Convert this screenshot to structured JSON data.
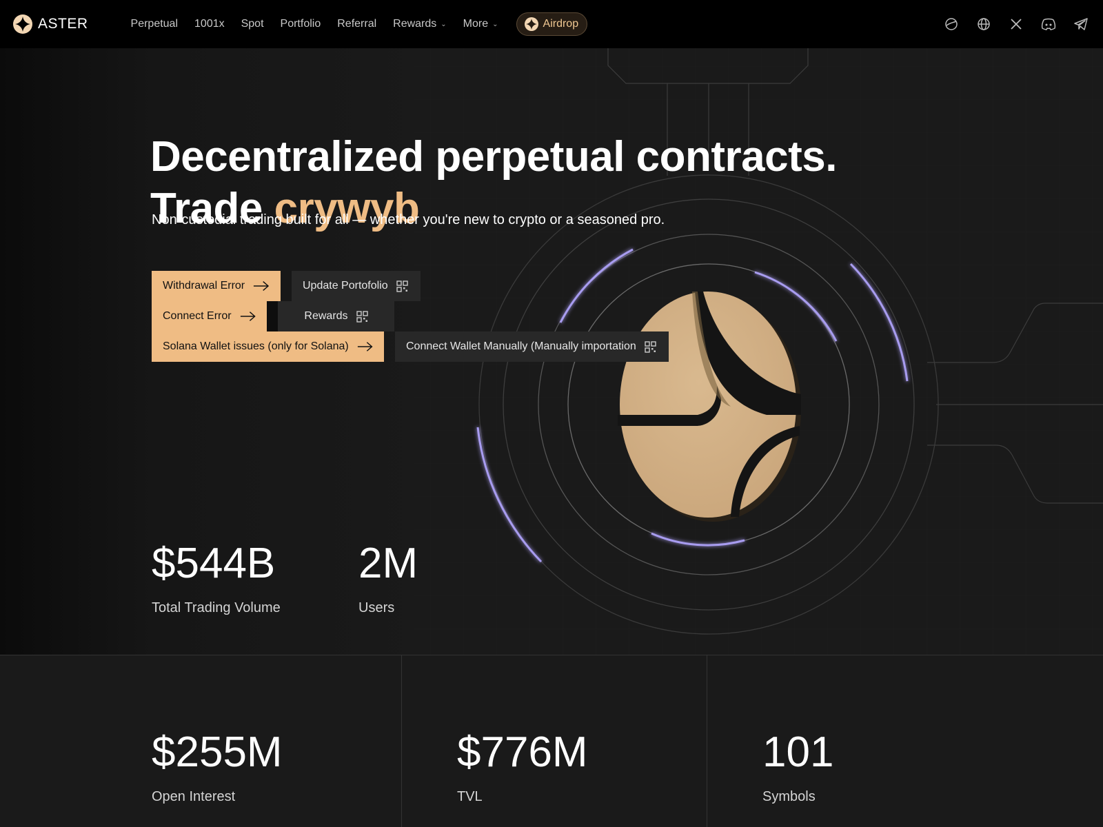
{
  "brand": {
    "name": "ASTER"
  },
  "nav": {
    "items": [
      {
        "label": "Perpetual"
      },
      {
        "label": "1001x"
      },
      {
        "label": "Spot"
      },
      {
        "label": "Portfolio"
      },
      {
        "label": "Referral"
      },
      {
        "label": "Rewards"
      },
      {
        "label": "More"
      }
    ],
    "airdrop_label": "Airdrop",
    "icons": [
      "theme-icon",
      "globe-icon",
      "x-twitter-icon",
      "discord-icon",
      "telegram-icon"
    ]
  },
  "hero": {
    "title_line1": "Decentralized perpetual contracts.",
    "title_line2_prefix": "Trade ",
    "title_line2_accent": "crywyb",
    "subtitle": "Non-custodial trading built for all — whether you're new to crypto or a seasoned pro."
  },
  "buttons": {
    "withdrawal_error": "Withdrawal Error",
    "update_portfolio": "Update Portofolio",
    "connect_error": "Connect Error",
    "rewards": "Rewards",
    "solana_issues": "Solana Wallet issues (only for Solana)",
    "connect_manually": "Connect Wallet Manually (Manually importation"
  },
  "stats_top": [
    {
      "value": "$544B",
      "label": "Total Trading Volume"
    },
    {
      "value": "2M",
      "label": "Users"
    }
  ],
  "stats_bottom": [
    {
      "value": "$255M",
      "label": "Open Interest"
    },
    {
      "value": "$776M",
      "label": "TVL"
    },
    {
      "value": "101",
      "label": "Symbols"
    }
  ],
  "colors": {
    "accent": "#efbc84",
    "background": "#1a1a1a",
    "nav_bg": "#000000",
    "glow": "#a89cf0"
  }
}
